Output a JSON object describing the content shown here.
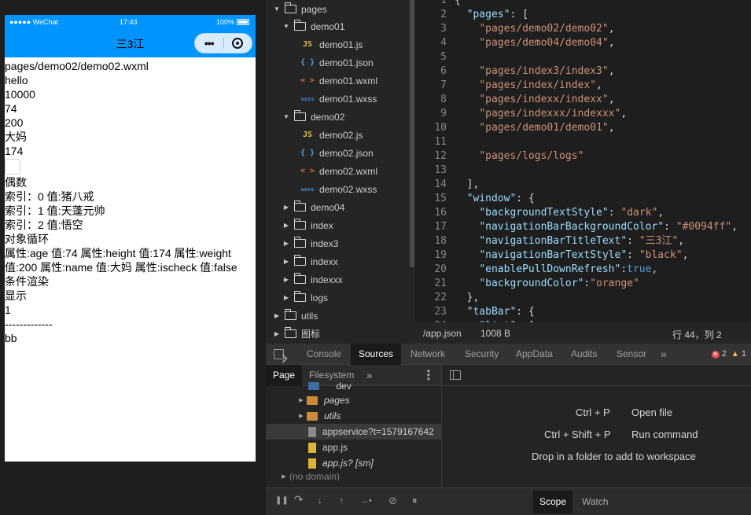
{
  "simulator": {
    "status": {
      "signal": "●●●●● WeChat",
      "time": "17:43",
      "battery": "100%"
    },
    "nav_title": "三3江",
    "capsule_more": "•••",
    "page_lines": [
      "pages/demo02/demo02.wxml",
      "hello",
      "10000",
      "74",
      "200",
      "大妈",
      "174"
    ],
    "page_lines_after": [
      "偶数",
      "索引：0 值:猪八戒",
      "索引：1 值:天蓬元帅",
      "索引：2 值:悟空",
      "对象循环",
      "属性:age 值:74 属性:height 值:174 属性:weight",
      "值:200 属性:name 值:大妈 属性:ischeck 值:false",
      "条件渲染",
      "显示",
      "1",
      "-------------",
      "bb"
    ]
  },
  "explorer": {
    "items": [
      {
        "label": "pages",
        "type": "folder",
        "expanded": true
      },
      {
        "label": "demo01",
        "type": "folder",
        "expanded": true
      },
      {
        "label": "demo01.js",
        "type": "js"
      },
      {
        "label": "demo01.json",
        "type": "json"
      },
      {
        "label": "demo01.wxml",
        "type": "wxml"
      },
      {
        "label": "demo01.wxss",
        "type": "wxss"
      },
      {
        "label": "demo02",
        "type": "folder",
        "expanded": true
      },
      {
        "label": "demo02.js",
        "type": "js"
      },
      {
        "label": "demo02.json",
        "type": "json"
      },
      {
        "label": "demo02.wxml",
        "type": "wxml"
      },
      {
        "label": "demo02.wxss",
        "type": "wxss"
      },
      {
        "label": "demo04",
        "type": "folder",
        "expanded": false
      },
      {
        "label": "index",
        "type": "folder",
        "expanded": false
      },
      {
        "label": "index3",
        "type": "folder",
        "expanded": false
      },
      {
        "label": "indexx",
        "type": "folder",
        "expanded": false
      },
      {
        "label": "indexxx",
        "type": "folder",
        "expanded": false
      },
      {
        "label": "logs",
        "type": "folder",
        "expanded": false
      },
      {
        "label": "utils",
        "type": "folder",
        "expanded": false
      },
      {
        "label": "图标",
        "type": "folder",
        "expanded": false
      }
    ],
    "icons": {
      "js": "JS",
      "json": "{ }",
      "wxml": "< >",
      "wxss": "wxss"
    }
  },
  "editor": {
    "lines": [
      {
        "n": "1",
        "html": "<span class='p'>{</span>"
      },
      {
        "n": "2",
        "html": "  <span class='k'>\"pages\"</span><span class='p'>: [</span>"
      },
      {
        "n": "3",
        "html": "    <span class='s'>\"pages/demo02/demo02\"</span><span class='p'>,</span>"
      },
      {
        "n": "4",
        "html": "    <span class='s'>\"pages/demo04/demo04\"</span><span class='p'>,</span>"
      },
      {
        "n": "5",
        "html": ""
      },
      {
        "n": "6",
        "html": "    <span class='s'>\"pages/index3/index3\"</span><span class='p'>,</span>"
      },
      {
        "n": "7",
        "html": "    <span class='s'>\"pages/index/index\"</span><span class='p'>,</span>"
      },
      {
        "n": "8",
        "html": "    <span class='s'>\"pages/indexx/indexx\"</span><span class='p'>,</span>"
      },
      {
        "n": "9",
        "html": "    <span class='s'>\"pages/indexxx/indexxx\"</span><span class='p'>,</span>"
      },
      {
        "n": "10",
        "html": "    <span class='s'>\"pages/demo01/demo01\"</span><span class='p'>,</span>"
      },
      {
        "n": "11",
        "html": ""
      },
      {
        "n": "12",
        "html": "    <span class='s'>\"pages/logs/logs\"</span>"
      },
      {
        "n": "13",
        "html": ""
      },
      {
        "n": "14",
        "html": "  <span class='p'>],</span>"
      },
      {
        "n": "15",
        "html": "  <span class='k'>\"window\"</span><span class='p'>: {</span>"
      },
      {
        "n": "16",
        "html": "    <span class='k'>\"backgroundTextStyle\"</span><span class='p'>: </span><span class='s'>\"dark\"</span><span class='p'>,</span>"
      },
      {
        "n": "17",
        "html": "    <span class='k'>\"navigationBarBackgroundColor\"</span><span class='p'>: </span><span class='s'>\"#0094ff\"</span><span class='p'>,</span>"
      },
      {
        "n": "18",
        "html": "    <span class='k'>\"navigationBarTitleText\"</span><span class='p'>: </span><span class='s'>\"三3江\"</span><span class='p'>,</span>"
      },
      {
        "n": "19",
        "html": "    <span class='k'>\"navigationBarTextStyle\"</span><span class='p'>: </span><span class='s'>\"black\"</span><span class='p'>,</span>"
      },
      {
        "n": "20",
        "html": "    <span class='k'>\"enablePullDownRefresh\"</span><span class='p'>:</span><span class='b'>true</span><span class='p'>,</span>"
      },
      {
        "n": "21",
        "html": "    <span class='k'>\"backgroundColor\"</span><span class='p'>:</span><span class='s'>\"orange\"</span>"
      },
      {
        "n": "22",
        "html": "  <span class='p'>},</span>"
      },
      {
        "n": "23",
        "html": "  <span class='k'>\"tabBar\"</span><span class='p'>: {</span>"
      },
      {
        "n": "24",
        "html": "    <span class='k'>\"list\"</span><span class='p'>: [</span>"
      }
    ],
    "status": {
      "file": "/app.json",
      "size": "1008 B",
      "position": "行 44，列 2"
    }
  },
  "devtools": {
    "tabs": [
      "Console",
      "Sources",
      "Network",
      "Security",
      "AppData",
      "Audits",
      "Sensor"
    ],
    "active_tab": "Sources",
    "more": "»",
    "errors": "2",
    "warnings": "1",
    "sub_tabs": {
      "page": "Page",
      "filesystem": "Filesystem",
      "more": "»"
    },
    "sources": [
      {
        "label": "__dev__",
        "kind": "folder-partial"
      },
      {
        "label": "pages",
        "kind": "folder"
      },
      {
        "label": "utils",
        "kind": "folder"
      },
      {
        "label": "appservice?t=1579167642",
        "kind": "file-gray"
      },
      {
        "label": "app.js",
        "kind": "file-yellow"
      },
      {
        "label": "app.js? [sm]",
        "kind": "file-yellow-italic"
      },
      {
        "label": "(no domain)",
        "kind": "cloud-partial"
      }
    ],
    "shortcuts": [
      {
        "keys": "Ctrl + P",
        "action": "Open file"
      },
      {
        "keys": "Ctrl + Shift + P",
        "action": "Run command"
      }
    ],
    "drop_hint": "Drop in a folder to add to workspace",
    "scope_tabs": {
      "scope": "Scope",
      "watch": "Watch"
    }
  }
}
